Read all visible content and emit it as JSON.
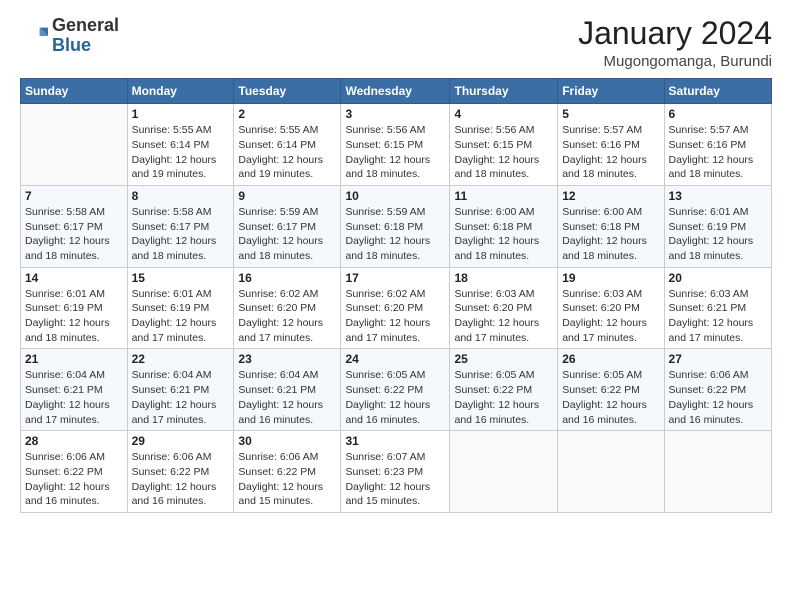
{
  "header": {
    "logo": {
      "line1": "General",
      "line2": "Blue"
    },
    "title": "January 2024",
    "subtitle": "Mugongomanga, Burundi"
  },
  "weekdays": [
    "Sunday",
    "Monday",
    "Tuesday",
    "Wednesday",
    "Thursday",
    "Friday",
    "Saturday"
  ],
  "weeks": [
    [
      {
        "day": "",
        "info": ""
      },
      {
        "day": "1",
        "info": "Sunrise: 5:55 AM\nSunset: 6:14 PM\nDaylight: 12 hours\nand 19 minutes."
      },
      {
        "day": "2",
        "info": "Sunrise: 5:55 AM\nSunset: 6:14 PM\nDaylight: 12 hours\nand 19 minutes."
      },
      {
        "day": "3",
        "info": "Sunrise: 5:56 AM\nSunset: 6:15 PM\nDaylight: 12 hours\nand 18 minutes."
      },
      {
        "day": "4",
        "info": "Sunrise: 5:56 AM\nSunset: 6:15 PM\nDaylight: 12 hours\nand 18 minutes."
      },
      {
        "day": "5",
        "info": "Sunrise: 5:57 AM\nSunset: 6:16 PM\nDaylight: 12 hours\nand 18 minutes."
      },
      {
        "day": "6",
        "info": "Sunrise: 5:57 AM\nSunset: 6:16 PM\nDaylight: 12 hours\nand 18 minutes."
      }
    ],
    [
      {
        "day": "7",
        "info": "Sunrise: 5:58 AM\nSunset: 6:17 PM\nDaylight: 12 hours\nand 18 minutes."
      },
      {
        "day": "8",
        "info": "Sunrise: 5:58 AM\nSunset: 6:17 PM\nDaylight: 12 hours\nand 18 minutes."
      },
      {
        "day": "9",
        "info": "Sunrise: 5:59 AM\nSunset: 6:17 PM\nDaylight: 12 hours\nand 18 minutes."
      },
      {
        "day": "10",
        "info": "Sunrise: 5:59 AM\nSunset: 6:18 PM\nDaylight: 12 hours\nand 18 minutes."
      },
      {
        "day": "11",
        "info": "Sunrise: 6:00 AM\nSunset: 6:18 PM\nDaylight: 12 hours\nand 18 minutes."
      },
      {
        "day": "12",
        "info": "Sunrise: 6:00 AM\nSunset: 6:18 PM\nDaylight: 12 hours\nand 18 minutes."
      },
      {
        "day": "13",
        "info": "Sunrise: 6:01 AM\nSunset: 6:19 PM\nDaylight: 12 hours\nand 18 minutes."
      }
    ],
    [
      {
        "day": "14",
        "info": "Sunrise: 6:01 AM\nSunset: 6:19 PM\nDaylight: 12 hours\nand 18 minutes."
      },
      {
        "day": "15",
        "info": "Sunrise: 6:01 AM\nSunset: 6:19 PM\nDaylight: 12 hours\nand 17 minutes."
      },
      {
        "day": "16",
        "info": "Sunrise: 6:02 AM\nSunset: 6:20 PM\nDaylight: 12 hours\nand 17 minutes."
      },
      {
        "day": "17",
        "info": "Sunrise: 6:02 AM\nSunset: 6:20 PM\nDaylight: 12 hours\nand 17 minutes."
      },
      {
        "day": "18",
        "info": "Sunrise: 6:03 AM\nSunset: 6:20 PM\nDaylight: 12 hours\nand 17 minutes."
      },
      {
        "day": "19",
        "info": "Sunrise: 6:03 AM\nSunset: 6:20 PM\nDaylight: 12 hours\nand 17 minutes."
      },
      {
        "day": "20",
        "info": "Sunrise: 6:03 AM\nSunset: 6:21 PM\nDaylight: 12 hours\nand 17 minutes."
      }
    ],
    [
      {
        "day": "21",
        "info": "Sunrise: 6:04 AM\nSunset: 6:21 PM\nDaylight: 12 hours\nand 17 minutes."
      },
      {
        "day": "22",
        "info": "Sunrise: 6:04 AM\nSunset: 6:21 PM\nDaylight: 12 hours\nand 17 minutes."
      },
      {
        "day": "23",
        "info": "Sunrise: 6:04 AM\nSunset: 6:21 PM\nDaylight: 12 hours\nand 16 minutes."
      },
      {
        "day": "24",
        "info": "Sunrise: 6:05 AM\nSunset: 6:22 PM\nDaylight: 12 hours\nand 16 minutes."
      },
      {
        "day": "25",
        "info": "Sunrise: 6:05 AM\nSunset: 6:22 PM\nDaylight: 12 hours\nand 16 minutes."
      },
      {
        "day": "26",
        "info": "Sunrise: 6:05 AM\nSunset: 6:22 PM\nDaylight: 12 hours\nand 16 minutes."
      },
      {
        "day": "27",
        "info": "Sunrise: 6:06 AM\nSunset: 6:22 PM\nDaylight: 12 hours\nand 16 minutes."
      }
    ],
    [
      {
        "day": "28",
        "info": "Sunrise: 6:06 AM\nSunset: 6:22 PM\nDaylight: 12 hours\nand 16 minutes."
      },
      {
        "day": "29",
        "info": "Sunrise: 6:06 AM\nSunset: 6:22 PM\nDaylight: 12 hours\nand 16 minutes."
      },
      {
        "day": "30",
        "info": "Sunrise: 6:06 AM\nSunset: 6:22 PM\nDaylight: 12 hours\nand 15 minutes."
      },
      {
        "day": "31",
        "info": "Sunrise: 6:07 AM\nSunset: 6:23 PM\nDaylight: 12 hours\nand 15 minutes."
      },
      {
        "day": "",
        "info": ""
      },
      {
        "day": "",
        "info": ""
      },
      {
        "day": "",
        "info": ""
      }
    ]
  ]
}
